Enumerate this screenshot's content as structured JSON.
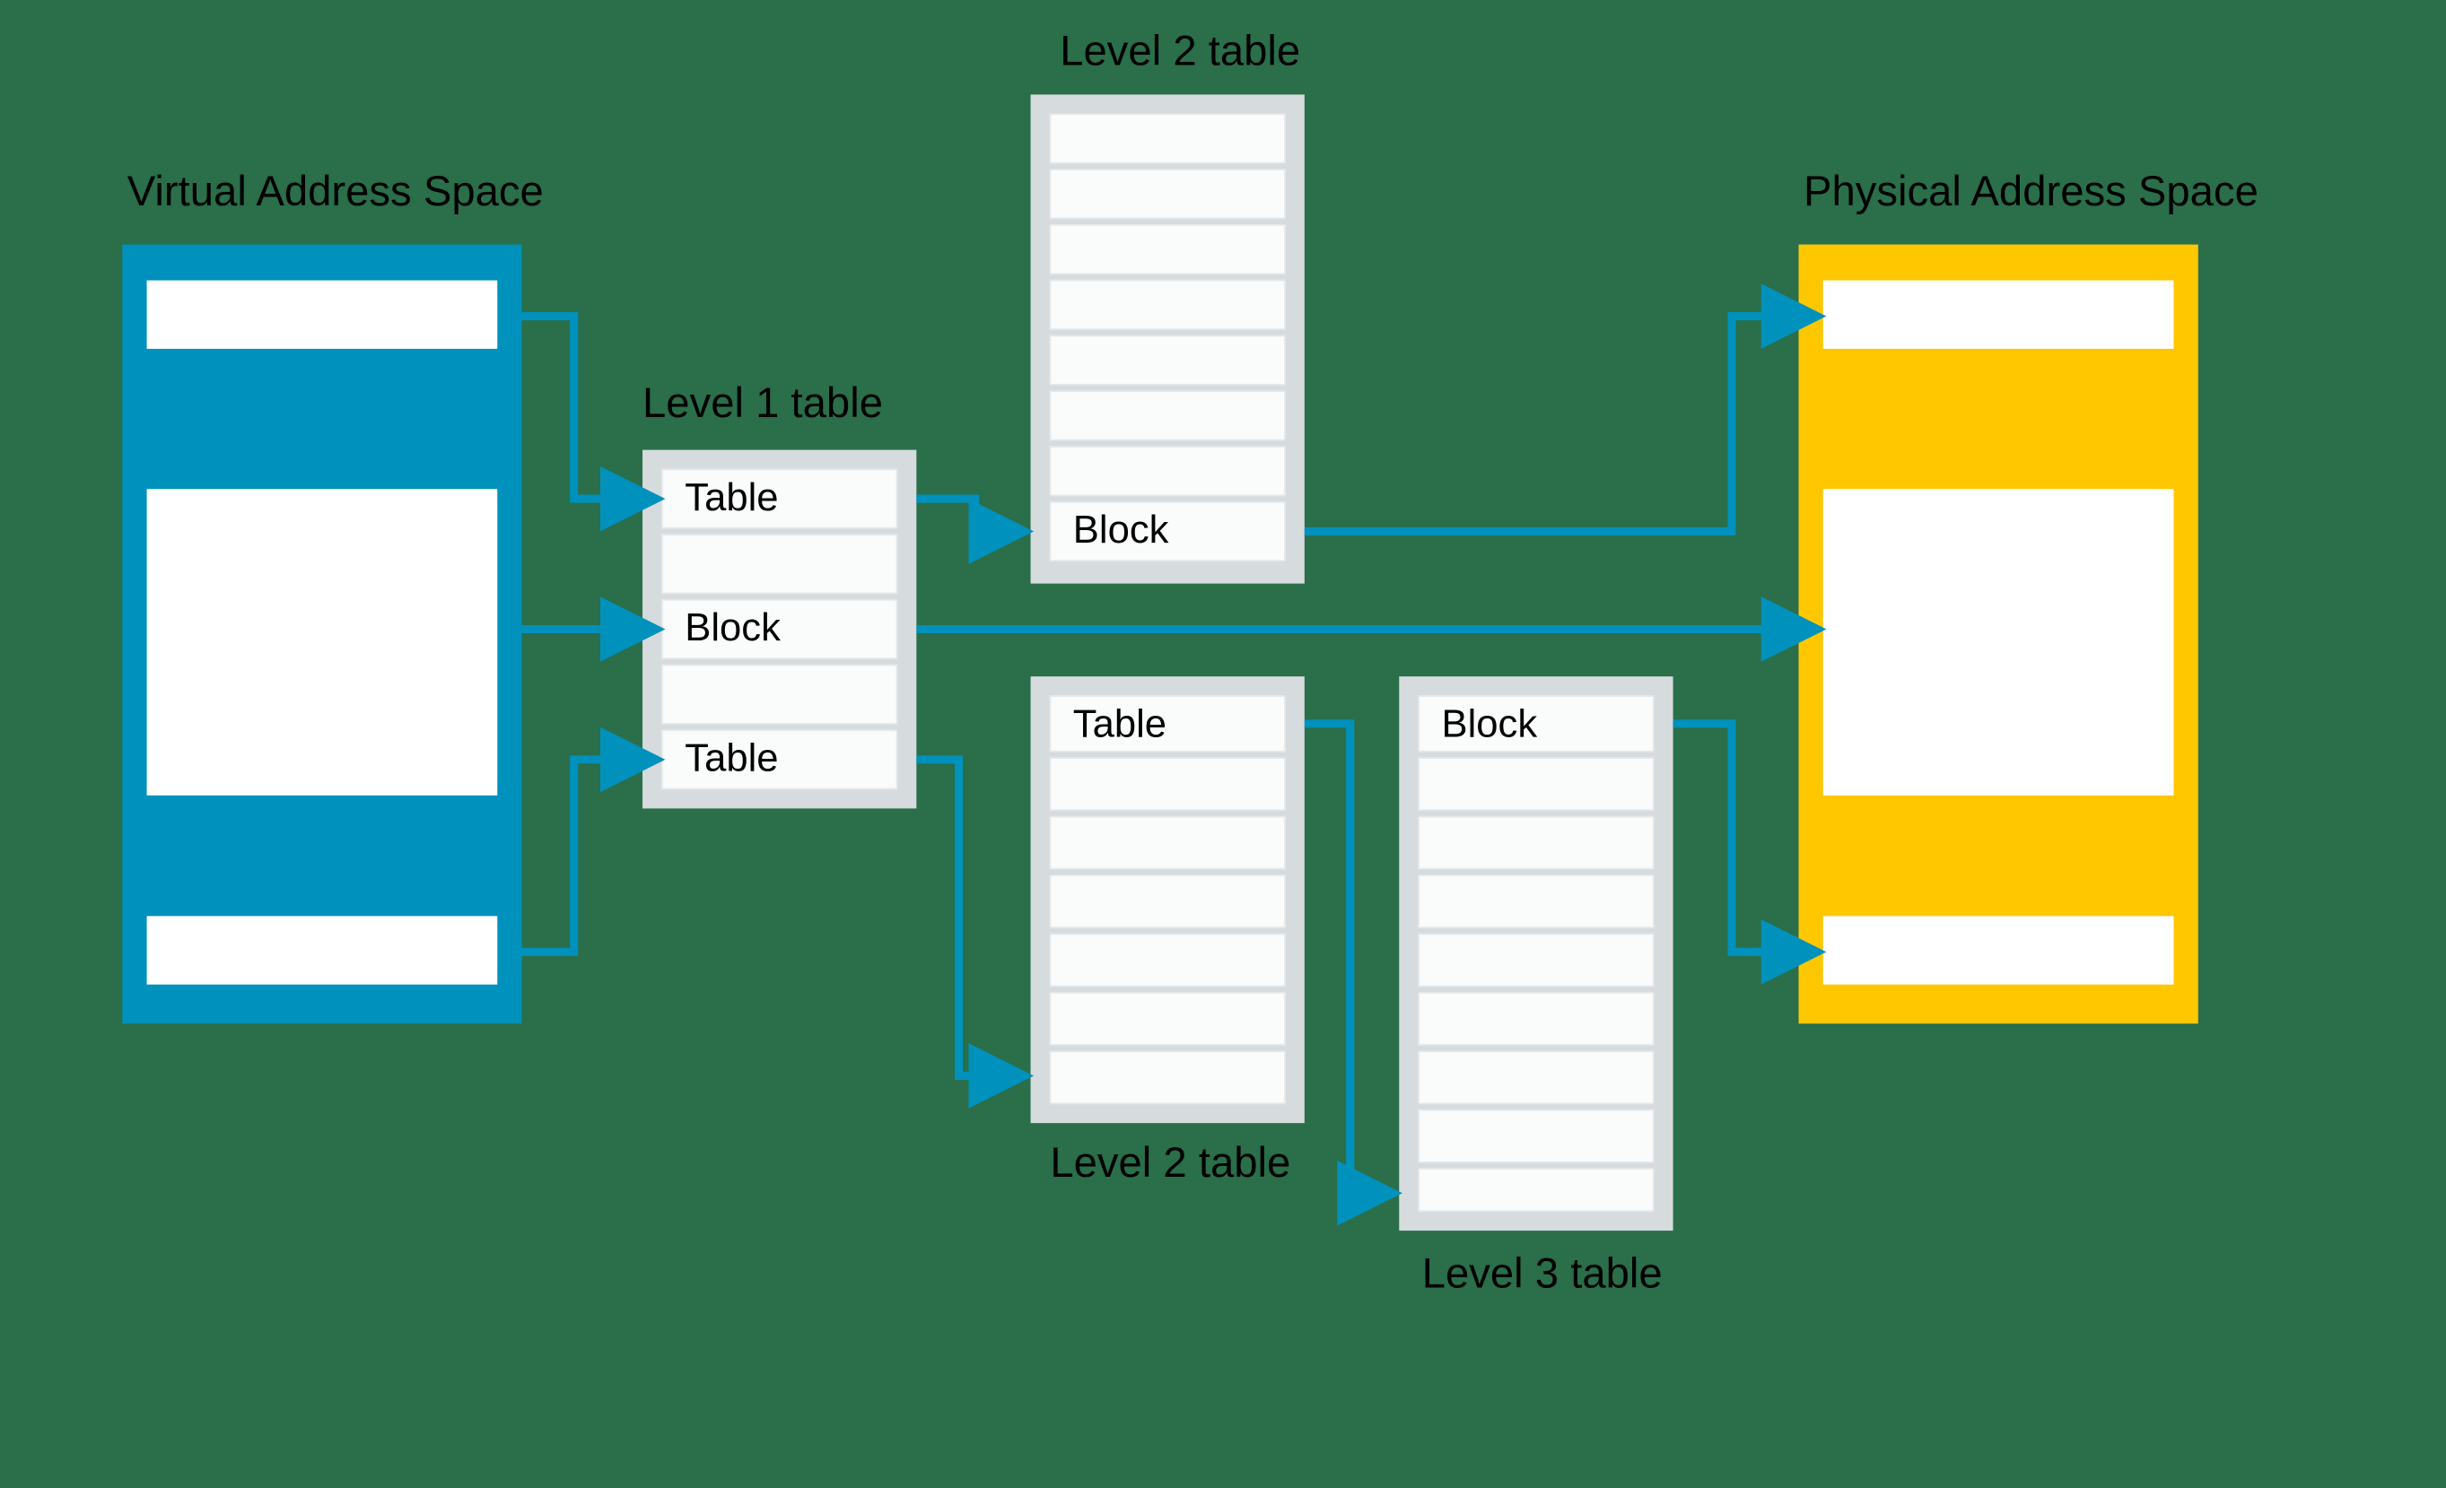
{
  "labels": {
    "vas": "Virtual Address Space",
    "pas": "Physical Address Space",
    "l1": "Level 1 table",
    "l2_top": "Level 2 table",
    "l2_bottom": "Level 2 table",
    "l3": "Level 3 table"
  },
  "cells": {
    "l1_r0": "Table",
    "l1_r2": "Block",
    "l1_r4": "Table",
    "l2a_r7": "Block",
    "l2b_r0": "Table",
    "l3_r0": "Block"
  },
  "colors": {
    "blue_box": "#0091bd",
    "yellow_box": "#ffc700",
    "gray_box": "#d6dbdd",
    "row_fill": "#ffffff",
    "row_fill_gray": "#fafbfb",
    "row_stroke": "#e5e8ea",
    "conn": "#0091bd"
  }
}
